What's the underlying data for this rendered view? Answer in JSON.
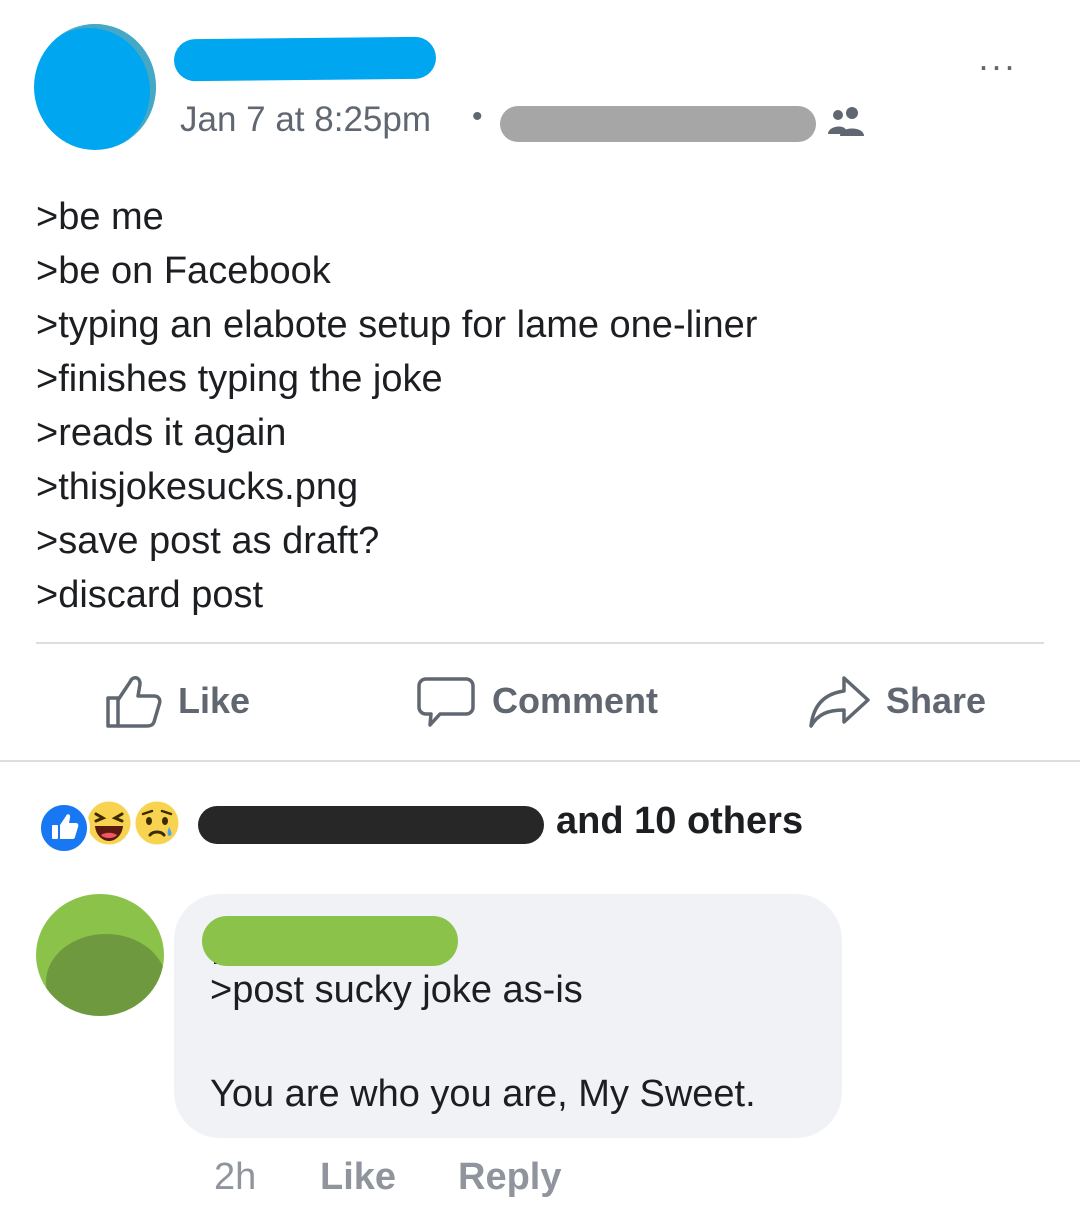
{
  "post": {
    "timestamp": "Jan 7 at 8:25pm",
    "separator": "•",
    "audience_icon": "friends-icon",
    "more_icon": "more-options-icon",
    "more_label": "...",
    "lines": [
      ">be me",
      ">be on Facebook",
      ">typing an elabote setup for lame one-liner",
      ">finishes typing the joke",
      ">reads it again",
      ">thisjokesucks.png",
      ">save post as draft?",
      ">discard post"
    ]
  },
  "actions": {
    "like_label": "Like",
    "comment_label": "Comment",
    "share_label": "Share"
  },
  "reactions": {
    "icons": [
      "like-reaction-icon",
      "haha-reaction-icon",
      "sad-reaction-icon"
    ],
    "others_text": "and 10 others"
  },
  "comment": {
    "line_1": ">post sucky joke as-is",
    "line_2": "You are who you are, My Sweet.",
    "time": "2h",
    "like_label": "Like",
    "reply_label": "Reply"
  },
  "colors": {
    "redaction_blue": "#00a6ef",
    "redaction_gray": "#a6a6a6",
    "redaction_black": "#272727",
    "redaction_green": "#8bc34a",
    "like_blue": "#1877f2",
    "secondary_text": "#606770"
  }
}
